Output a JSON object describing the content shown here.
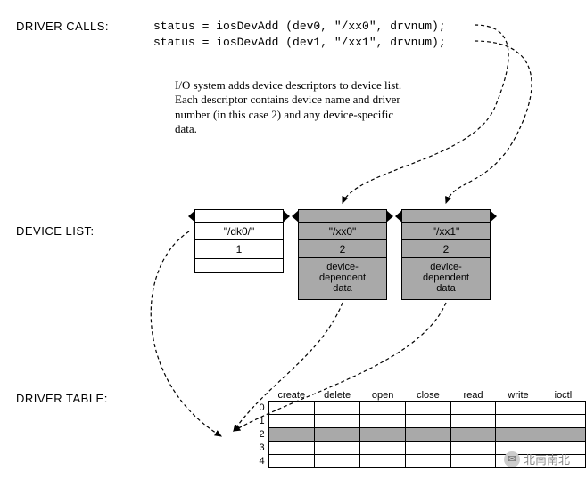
{
  "labels": {
    "driver_calls": "DRIVER CALLS:",
    "device_list": "DEVICE LIST:",
    "driver_table": "DRIVER TABLE:"
  },
  "code": {
    "line1": "status = iosDevAdd (dev0, \"/xx0\", drvnum);",
    "line2": "status = iosDevAdd (dev1, \"/xx1\", drvnum);"
  },
  "description": "I/O system adds device descriptors to device list. Each descriptor contains device name and driver number (in this case 2) and any device-specific data.",
  "devices": [
    {
      "name": "\"/dk0/\"",
      "num": "1",
      "data": ""
    },
    {
      "name": "\"/xx0\"",
      "num": "2",
      "data": "device-\ndependent\ndata"
    },
    {
      "name": "\"/xx1\"",
      "num": "2",
      "data": "device-\ndependent\ndata"
    }
  ],
  "driver_table": {
    "headers": [
      "create",
      "delete",
      "open",
      "close",
      "read",
      "write",
      "ioctl"
    ],
    "rows": [
      "0",
      "1",
      "2",
      "3",
      "4"
    ],
    "highlighted_row": "2"
  },
  "watermark": "北南南北"
}
